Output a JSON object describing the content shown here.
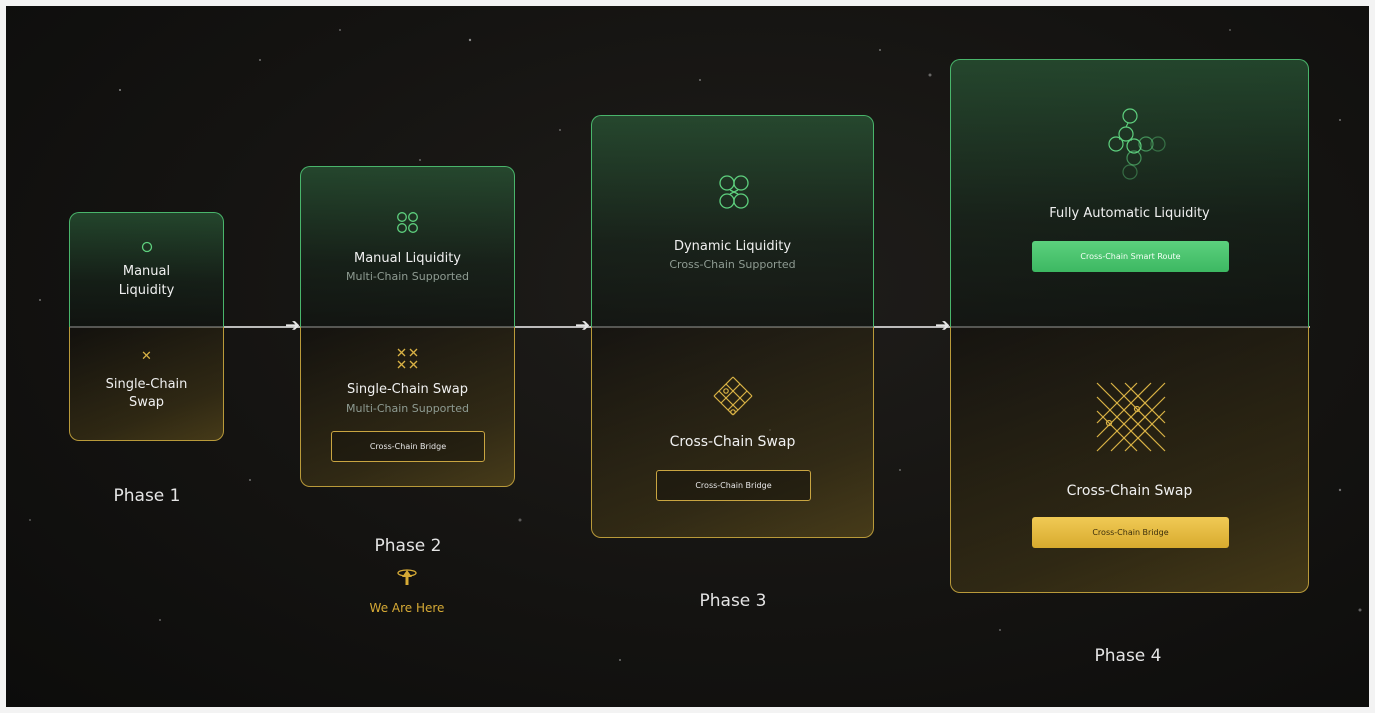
{
  "phases": [
    {
      "label": "Phase 1",
      "liquidity": {
        "title_line1": "Manual",
        "title_line2": "Liquidity",
        "icon": "single-circle-icon"
      },
      "swap": {
        "title_line1": "Single-Chain",
        "title_line2": "Swap",
        "icon": "single-x-icon"
      }
    },
    {
      "label": "Phase 2",
      "liquidity": {
        "title": "Manual Liquidity",
        "subtitle": "Multi-Chain Supported",
        "icon": "four-circles-icon"
      },
      "swap": {
        "title": "Single-Chain Swap",
        "subtitle": "Multi-Chain Supported",
        "icon": "four-x-icon",
        "button": "Cross-Chain Bridge"
      },
      "marker": {
        "label": "We Are Here",
        "icon": "location-arrow-icon"
      }
    },
    {
      "label": "Phase 3",
      "liquidity": {
        "title": "Dynamic Liquidity",
        "subtitle": "Cross-Chain Supported",
        "icon": "linked-circles-icon"
      },
      "swap": {
        "title": "Cross-Chain Swap",
        "icon": "diamond-lattice-icon",
        "button": "Cross-Chain Bridge"
      }
    },
    {
      "label": "Phase 4",
      "liquidity": {
        "title": "Fully Automatic Liquidity",
        "icon": "circle-network-icon",
        "button": "Cross-Chain Smart Route"
      },
      "swap": {
        "title": "Cross-Chain Swap",
        "icon": "dense-lattice-icon",
        "button": "Cross-Chain Bridge"
      }
    }
  ],
  "colors": {
    "green": "#49b56b",
    "gold": "#c9a541",
    "background": "#141311",
    "marker": "#d6aa35"
  }
}
